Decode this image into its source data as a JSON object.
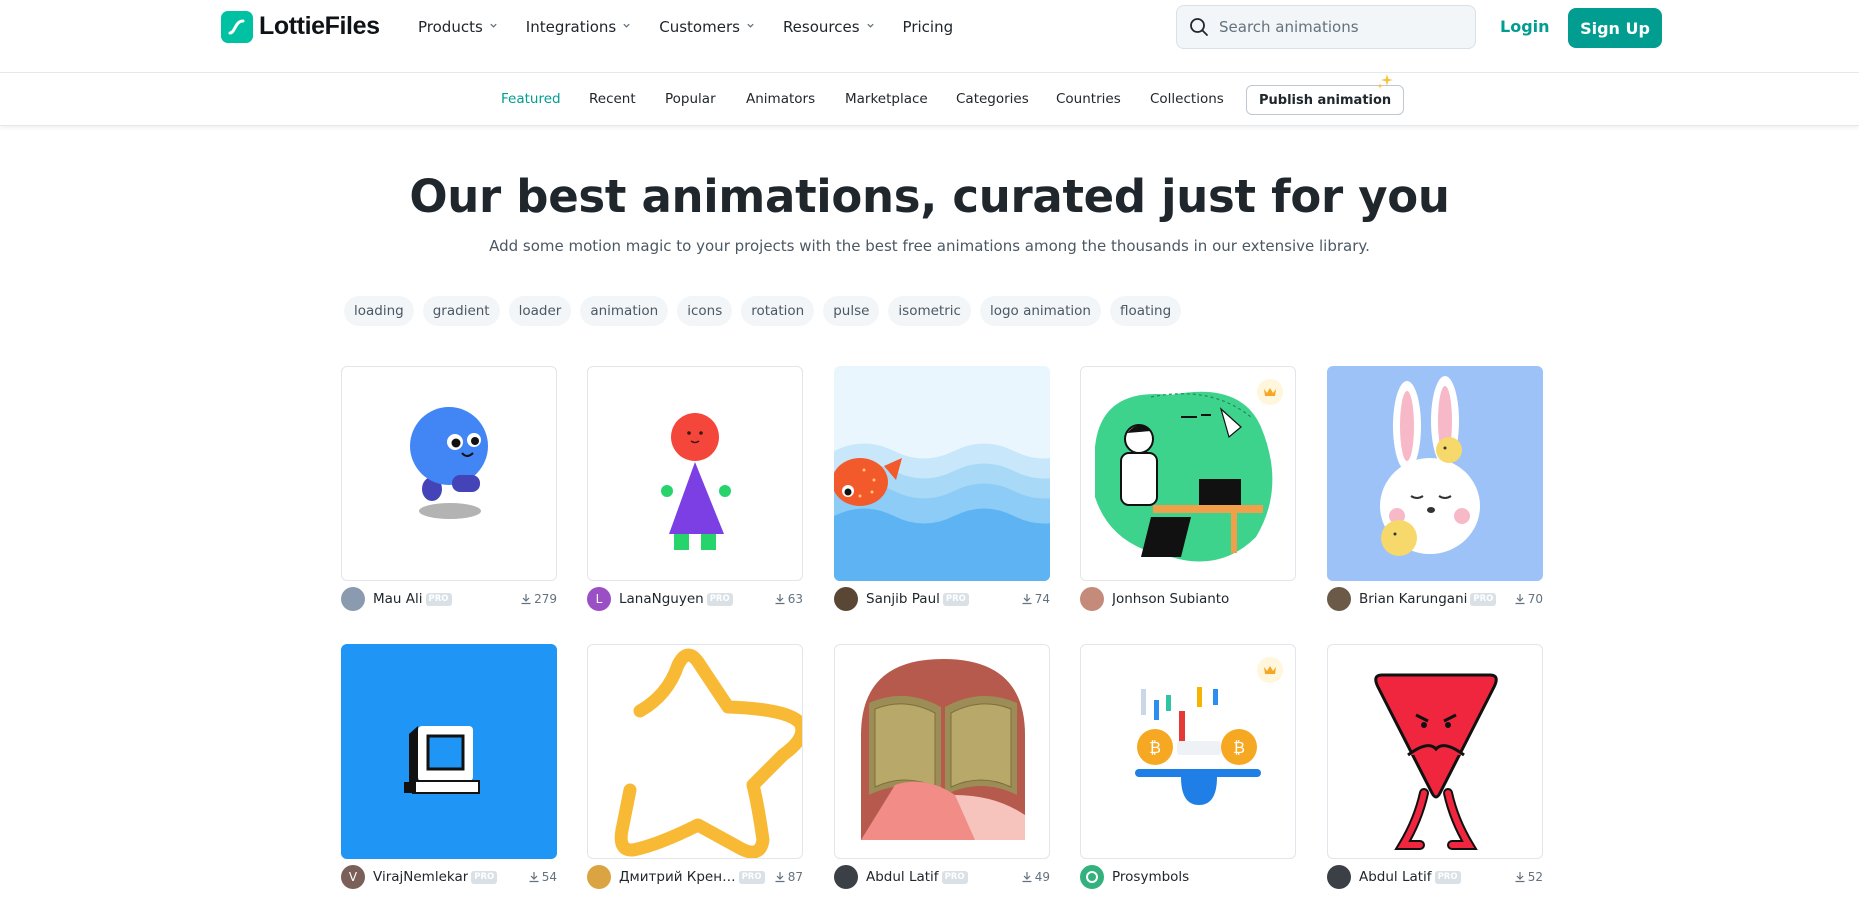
{
  "brand": {
    "name": "LottieFiles"
  },
  "header": {
    "nav": [
      {
        "label": "Products",
        "has_dropdown": true
      },
      {
        "label": "Integrations",
        "has_dropdown": true
      },
      {
        "label": "Customers",
        "has_dropdown": true
      },
      {
        "label": "Resources",
        "has_dropdown": true
      },
      {
        "label": "Pricing",
        "has_dropdown": false
      }
    ],
    "search_placeholder": "Search animations",
    "login_label": "Login",
    "signup_label": "Sign Up"
  },
  "subnav": {
    "tabs": [
      {
        "label": "Featured",
        "active": true
      },
      {
        "label": "Recent",
        "active": false
      },
      {
        "label": "Popular",
        "active": false
      },
      {
        "label": "Animators",
        "active": false
      },
      {
        "label": "Marketplace",
        "active": false
      },
      {
        "label": "Categories",
        "active": false
      },
      {
        "label": "Countries",
        "active": false
      },
      {
        "label": "Collections",
        "active": false
      }
    ],
    "publish_label": "Publish animation"
  },
  "hero": {
    "title": "Our best animations, curated just for you",
    "subtitle": "Add some motion magic to your projects with the best free animations among the thousands in our extensive library."
  },
  "tags": [
    "loading",
    "gradient",
    "loader",
    "animation",
    "icons",
    "rotation",
    "pulse",
    "isometric",
    "logo animation",
    "floating"
  ],
  "pro_badge": "PRO",
  "colors": {
    "accent": "#019d91",
    "brand": "#00c1a2"
  },
  "cards": [
    {
      "author": "Mau Ali",
      "pro": true,
      "downloads": "279",
      "premium": false,
      "avatar_initial": "",
      "avatar_color": "#8a9bb0",
      "art": "blue-blob"
    },
    {
      "author": "LanaNguyen",
      "pro": true,
      "downloads": "63",
      "premium": false,
      "avatar_initial": "L",
      "avatar_color": "#9b4fc4",
      "art": "dress-figure"
    },
    {
      "author": "Sanjib Paul",
      "pro": true,
      "downloads": "74",
      "premium": false,
      "avatar_initial": "",
      "avatar_color": "#5a4634",
      "art": "fish-waves"
    },
    {
      "author": "Jonhson Subianto",
      "pro": false,
      "downloads": "",
      "premium": true,
      "avatar_initial": "",
      "avatar_color": "#c48a7a",
      "art": "man-laptop"
    },
    {
      "author": "Brian Karungani",
      "pro": true,
      "downloads": "70",
      "premium": false,
      "avatar_initial": "",
      "avatar_color": "#6b5a48",
      "art": "bunny"
    },
    {
      "author": "VirajNemlekar",
      "pro": true,
      "downloads": "54",
      "premium": false,
      "avatar_initial": "V",
      "avatar_color": "#7a6058",
      "art": "computer"
    },
    {
      "author": "Дмитрий Крен…",
      "pro": true,
      "downloads": "87",
      "premium": false,
      "avatar_initial": "",
      "avatar_color": "#d9a441",
      "art": "star"
    },
    {
      "author": "Abdul Latif",
      "pro": true,
      "downloads": "49",
      "premium": false,
      "avatar_initial": "",
      "avatar_color": "#3b3f46",
      "art": "book"
    },
    {
      "author": "Prosymbols",
      "pro": false,
      "downloads": "",
      "premium": true,
      "avatar_initial": "",
      "avatar_color": "#34b27d",
      "art": "bitcoin"
    },
    {
      "author": "Abdul Latif",
      "pro": true,
      "downloads": "52",
      "premium": false,
      "avatar_initial": "",
      "avatar_color": "#3b3f46",
      "art": "triangle-guy"
    }
  ]
}
